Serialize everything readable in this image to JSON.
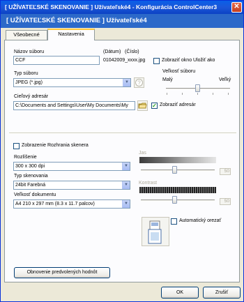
{
  "window": {
    "title": "[ UŽÍVATEĽSKÉ SKENOVANIE ]  Užívateľské4 - Konfigurácia ControlCenter3",
    "close_glyph": "✕"
  },
  "header": {
    "title": "[ UŽÍVATEĽSKÉ SKENOVANIE ]  Užívateľské4"
  },
  "tabs": [
    {
      "label": "Všeobecné",
      "active": false
    },
    {
      "label": "Nastavenia",
      "active": true
    }
  ],
  "file": {
    "name_label": "Názov súboru",
    "name_value": "CCF",
    "date_label": "(Dátum)",
    "number_label": "(Číslo)",
    "example": "01042009_xxxx.jpg",
    "save_as_window_label": "Zobraziť okno Uložiť ako",
    "save_as_window_checked": false
  },
  "file_type": {
    "label": "Typ súboru",
    "value": "JPEG (*.jpg)",
    "size_label": "Veľkosť súboru",
    "size_small": "Malý",
    "size_large": "Veľký"
  },
  "destination": {
    "label": "Cieľový adresár",
    "value": "C:\\Documents and Settings\\User\\My Documents\\My",
    "show_folder_label": "Zobraziť adresár",
    "show_folder_checked": true
  },
  "scanner_ui": {
    "label": "Zobrazenie Rozhrania skenera",
    "checked": false
  },
  "resolution": {
    "label": "Rozlíšenie",
    "value": "300 x 300 dpi"
  },
  "scan_type": {
    "label": "Typ skenovania",
    "value": "24bit Farebná"
  },
  "doc_size": {
    "label": "Veľkosť dokumentu",
    "value": "A4 210 x 297 mm (8.3 x 11.7 palcov)"
  },
  "brightness": {
    "label": "Jas",
    "value": "50"
  },
  "contrast": {
    "label": "Kontrast",
    "value": "50"
  },
  "auto_crop": {
    "label": "Automatický orezať",
    "checked": false
  },
  "buttons": {
    "restore": "Obnovenie predvolených hodnôt",
    "ok": "OK",
    "cancel": "Zrušiť"
  },
  "colors": {
    "title_bar": "#0b47d1",
    "header": "#2c69c9",
    "accent_tab": "#ffc73c"
  }
}
